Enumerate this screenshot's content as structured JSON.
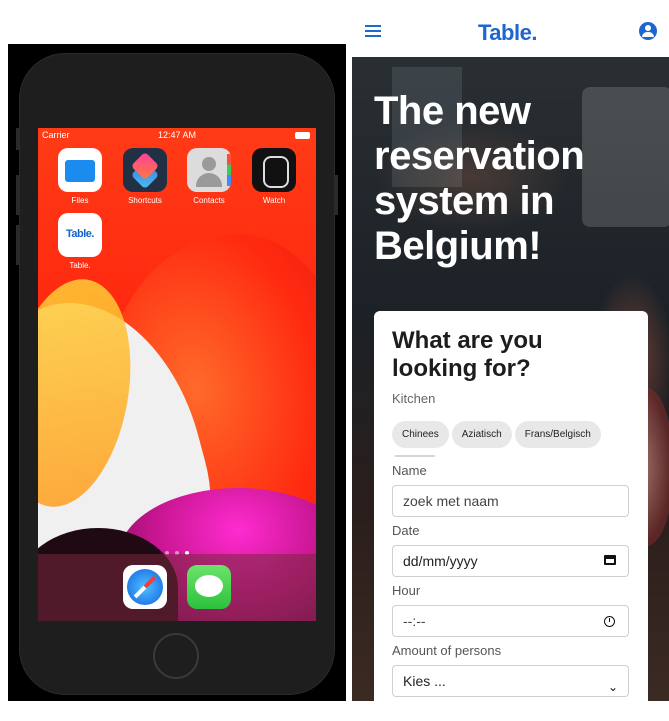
{
  "phone": {
    "status": {
      "carrier": "Carrier",
      "time": "12:47 AM"
    },
    "apps": [
      {
        "label": "Files",
        "icon": "files-icon"
      },
      {
        "label": "Shortcuts",
        "icon": "shortcuts-icon"
      },
      {
        "label": "Contacts",
        "icon": "contacts-icon"
      },
      {
        "label": "Watch",
        "icon": "watch-icon"
      },
      {
        "label": "Table.",
        "icon": "table-app-icon",
        "icon_text": "Table."
      }
    ],
    "dock": [
      {
        "icon": "safari-icon"
      },
      {
        "icon": "messages-icon"
      }
    ],
    "page_dots": 3,
    "active_page": 3
  },
  "header": {
    "brand": "Table.",
    "menu_icon": "menu-icon",
    "account_icon": "user-circle-icon"
  },
  "hero": {
    "title": "The new reservation system in Belgium!"
  },
  "search": {
    "title": "What are you looking for?",
    "kitchen_label": "Kitchen",
    "chips": [
      "Chinees",
      "Aziatisch",
      "Frans/Belgisch"
    ],
    "name_label": "Name",
    "name_placeholder": "zoek met naam",
    "date_label": "Date",
    "date_placeholder": "dd/mm/yyyy",
    "hour_label": "Hour",
    "hour_placeholder": "--:--",
    "persons_label": "Amount of persons",
    "persons_value": "Kies ..."
  },
  "colors": {
    "brand": "#1e66d0"
  }
}
